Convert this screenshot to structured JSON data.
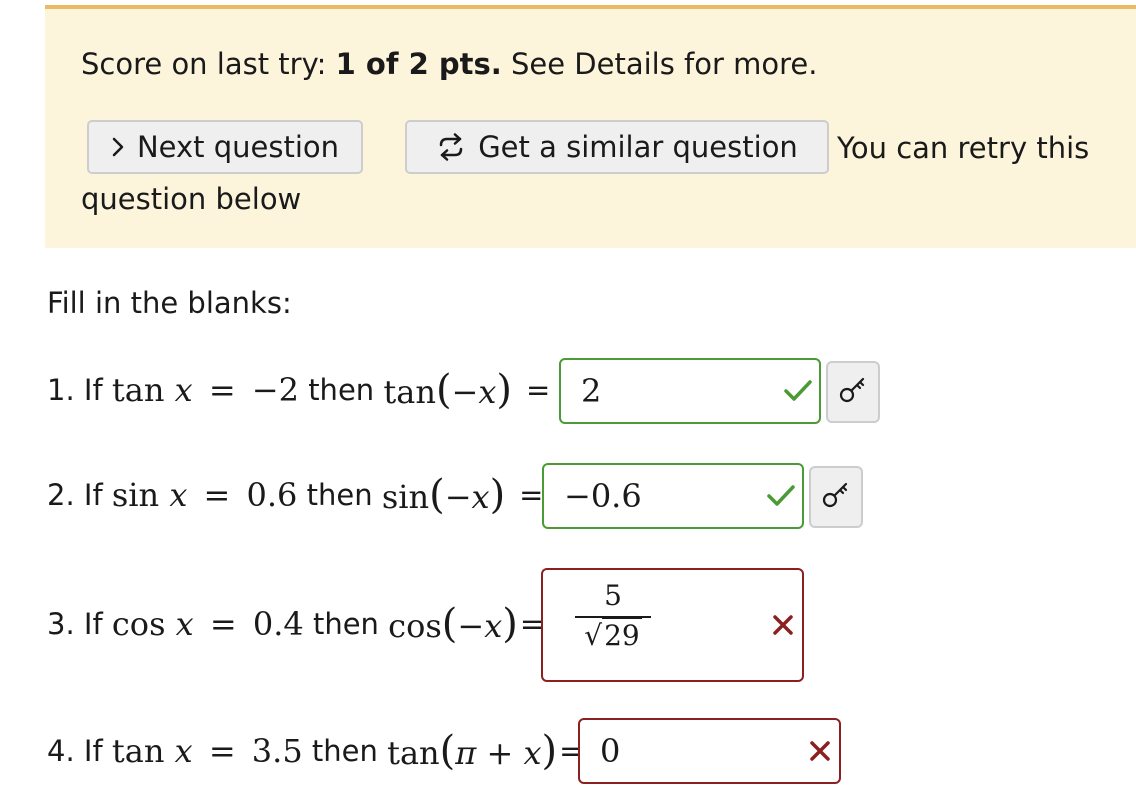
{
  "banner": {
    "score_prefix": "Score on last try: ",
    "score_bold": "1 of 2 pts.",
    "score_suffix": " See Details for more.",
    "next_button": "Next question",
    "similar_button": "Get a similar question",
    "retry_part1": "You can retry this",
    "retry_part2": "question below"
  },
  "instructions": "Fill in the blanks:",
  "questions": [
    {
      "number": "1. If",
      "func": "tan",
      "given": "−2",
      "then": "then",
      "target_func": "tan",
      "target_arg": "−x",
      "answer": "2",
      "status": "correct"
    },
    {
      "number": "2. If",
      "func": "sin",
      "given": "0.6",
      "then": "then",
      "target_func": "sin",
      "target_arg": "−x",
      "answer": "−0.6",
      "status": "correct"
    },
    {
      "number": "3. If",
      "func": "cos",
      "given": "0.4",
      "then": "then",
      "target_func": "cos",
      "target_arg": "−x",
      "answer_num": "5",
      "answer_den": "29",
      "status": "incorrect"
    },
    {
      "number": "4. If",
      "func": "tan",
      "given": "3.5",
      "then": "then",
      "target_func": "tan",
      "target_arg": "π + x",
      "answer": "0",
      "status": "incorrect"
    }
  ],
  "colors": {
    "banner_bg": "#fcf5dc",
    "banner_border": "#e9bc69",
    "correct": "#4a9a36",
    "incorrect": "#8b2020"
  },
  "icons": {
    "next": "chevron-right-icon",
    "similar": "refresh-icon",
    "correct": "check-icon",
    "incorrect": "x-icon",
    "answer_key": "key-icon"
  }
}
